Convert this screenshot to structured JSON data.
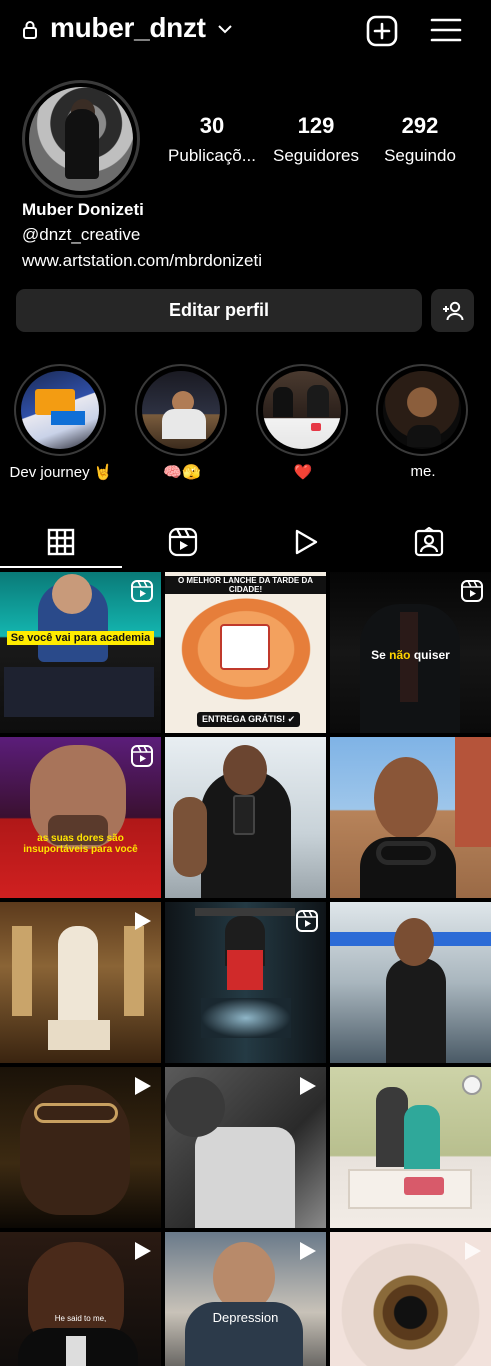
{
  "header": {
    "username": "muber_dnzt"
  },
  "profile": {
    "stats": [
      {
        "value": "30",
        "label": "Publicaçõ..."
      },
      {
        "value": "129",
        "label": "Seguidores"
      },
      {
        "value": "292",
        "label": "Seguindo"
      }
    ],
    "full_name": "Muber Donizeti",
    "handle": "@dnzt_creative",
    "link": "www.artstation.com/mbrdonizeti",
    "edit_label": "Editar perfil"
  },
  "highlights": [
    {
      "label": "Dev journey 🤘"
    },
    {
      "label": "🧠🫣"
    },
    {
      "label": "❤️"
    },
    {
      "label": "me."
    }
  ],
  "tabs": [
    {
      "icon": "grid-icon",
      "active": true
    },
    {
      "icon": "reels-icon",
      "active": false
    },
    {
      "icon": "play-icon",
      "active": false
    },
    {
      "icon": "tagged-icon",
      "active": false
    }
  ],
  "posts": {
    "p1_overlay": "Se você vai para academia",
    "p2_top": "O MELHOR LANCHE DA TARDE DA CIDADE!",
    "p2_bottom": "ENTREGA GRÁTIS! ✔",
    "p3_overlay_a": "Se",
    "p3_overlay_b": "não",
    "p3_overlay_c": "quiser",
    "p4_overlay": "as suas dores são insuportáveis para você",
    "p14_overlay": "He said to me,",
    "p15_overlay": "Depression"
  },
  "colors": {
    "background": "#000000",
    "button": "#262626",
    "accent_yellow": "#ffec00",
    "heart": "#ff2d3d"
  }
}
